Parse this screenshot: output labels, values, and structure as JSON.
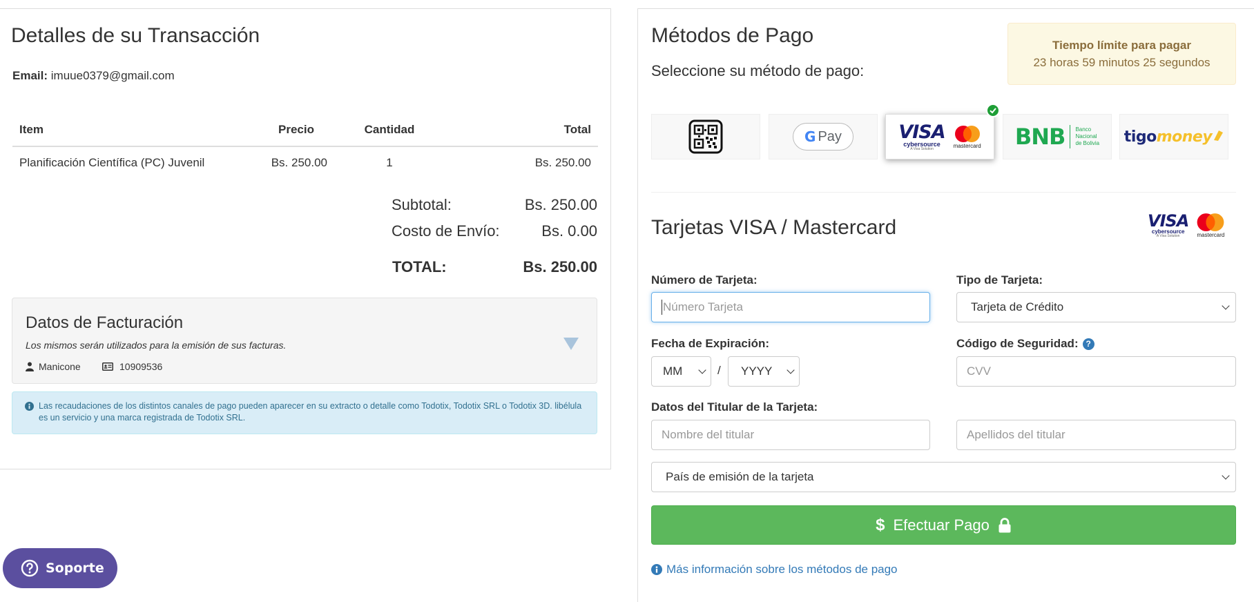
{
  "transaction": {
    "title": "Detalles de su Transacción",
    "email_label": "Email:",
    "email_value": "imuue0379@gmail.com",
    "columns": {
      "item": "Item",
      "price": "Precio",
      "qty": "Cantidad",
      "total": "Total"
    },
    "rows": [
      {
        "item": "Planificación Científica (PC) Juvenil",
        "price": "Bs. 250.00",
        "qty": "1",
        "total": "Bs. 250.00"
      }
    ],
    "subtotal_label": "Subtotal:",
    "subtotal_value": "Bs. 250.00",
    "shipping_label": "Costo de Envío:",
    "shipping_value": "Bs. 0.00",
    "total_label": "TOTAL:",
    "total_value": "Bs. 250.00"
  },
  "billing": {
    "title": "Datos de Facturación",
    "subtitle": "Los mismos serán utilizados para la emisión de sus facturas.",
    "name": "Manicone",
    "nit": "10909536"
  },
  "notice": "Las recaudaciones de los distintos canales de pago pueden aparecer en su extracto o detalle como Todotix, Todotix SRL o Todotix 3D. libélula es un servicio y una marca registrada de Todotix SRL.",
  "payment": {
    "title": "Métodos de Pago",
    "subtitle": "Seleccione su método de pago:",
    "timer_title": "Tiempo límite para pagar",
    "timer_value": "23 horas 59 minutos 25 segundos",
    "methods": {
      "gpay_g": "G",
      "gpay_text": "Pay",
      "visa": "VISA",
      "cybersource": "cybersource",
      "visa_solution": "A Visa Solution",
      "mastercard": "mastercard",
      "bnb": "BNB",
      "bnb_sub1": "Banco",
      "bnb_sub2": "Nacional",
      "bnb_sub3": "de Bolivia",
      "tigo": "tigo",
      "money": "money"
    },
    "selected_method": "visa-mastercard",
    "cards_title": "Tarjetas VISA / Mastercard",
    "card_number_label": "Número de Tarjeta:",
    "card_number_placeholder": "Número Tarjeta",
    "card_type_label": "Tipo de Tarjeta:",
    "card_type_value": "Tarjeta de Crédito",
    "expiry_label": "Fecha de Expiración:",
    "expiry_month": "MM",
    "expiry_sep": "/",
    "expiry_year": "YYYY",
    "cvv_label": "Código de Seguridad:",
    "cvv_help": "?",
    "cvv_placeholder": "CVV",
    "holder_label": "Datos del Titular de la Tarjeta:",
    "holder_first_placeholder": "Nombre del titular",
    "holder_last_placeholder": "Apellidos del titular",
    "country_placeholder": "País de emisión de la tarjeta",
    "pay_button": "Efectuar Pago",
    "more_info": "Más información sobre los métodos de pago"
  },
  "support": {
    "label": "Soporte"
  },
  "colors": {
    "pay_green": "#5cb85c",
    "link_blue": "#337ab7",
    "support_purple": "#5b4f9f",
    "check_green": "#1e9e36",
    "visa_navy": "#1a1f71",
    "bnb_green": "#1fa851",
    "tigo_navy": "#1e2a78",
    "money_yellow": "#f5c02b"
  }
}
